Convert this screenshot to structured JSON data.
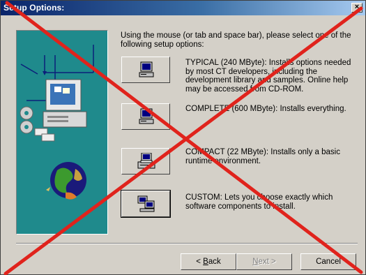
{
  "window": {
    "title": "Setup Options:",
    "close_glyph": "×"
  },
  "intro": "Using the mouse (or tab and space bar), please select one of the following setup options:",
  "options": [
    {
      "name": "typical",
      "text": "TYPICAL (240 MByte): Installs options needed by most CT developers, including the development library and samples.  Online help may be accessed from CD-ROM.",
      "icon": "computer-icon"
    },
    {
      "name": "complete",
      "text": "COMPLETE (600 MByte): Installs everything.",
      "icon": "computer-icon"
    },
    {
      "name": "compact",
      "text": "COMPACT (22 MByte): Installs only a basic runtime environment.",
      "icon": "printer-computer-icon"
    },
    {
      "name": "custom",
      "text": "CUSTOM: Lets you choose exactly which software components to install.",
      "icon": "multiple-computers-icon"
    }
  ],
  "buttons": {
    "back": {
      "prefix": "< ",
      "key": "B",
      "rest": "ack",
      "enabled": true
    },
    "next": {
      "prefix": "",
      "key": "N",
      "rest": "ext >",
      "enabled": false
    },
    "cancel": {
      "label": "Cancel",
      "enabled": true
    }
  },
  "colors": {
    "title_start": "#0a246a",
    "title_end": "#a6caf0",
    "face": "#d4d0c8",
    "art_bg": "#1f8a8c",
    "cross": "#e0231c"
  }
}
